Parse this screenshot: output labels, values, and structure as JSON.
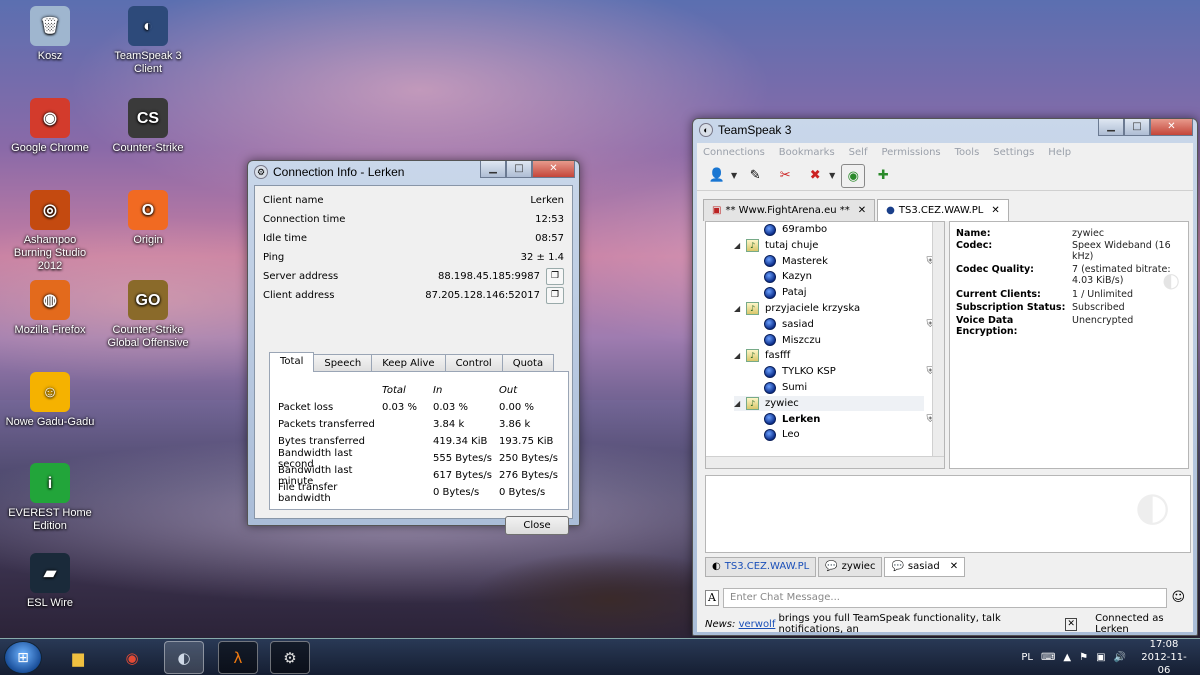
{
  "desktop": {
    "icons": [
      {
        "label": "Kosz",
        "glyph": "🗑",
        "color": "#9fb6cf"
      },
      {
        "label": "TeamSpeak 3 Client",
        "glyph": "◐",
        "color": "#2d4a7a"
      },
      {
        "label": "Google Chrome",
        "glyph": "◉",
        "color": "#d33b2c"
      },
      {
        "label": "Counter-Strike",
        "glyph": "CS",
        "color": "#3a3a3a"
      },
      {
        "label": "Ashampoo Burning Studio 2012",
        "glyph": "◎",
        "color": "#c44a10"
      },
      {
        "label": "Origin",
        "glyph": "O",
        "color": "#f16a22"
      },
      {
        "label": "Mozilla Firefox",
        "glyph": "◍",
        "color": "#e36a1c"
      },
      {
        "label": "Counter-Strike Global Offensive",
        "glyph": "GO",
        "color": "#8a6a2a"
      },
      {
        "label": "Nowe Gadu-Gadu",
        "glyph": "☺",
        "color": "#f5b200"
      },
      {
        "label": "EVEREST Home Edition",
        "glyph": "i",
        "color": "#22a53a"
      },
      {
        "label": "ESL Wire",
        "glyph": "▰",
        "color": "#1a2a3a"
      }
    ]
  },
  "conn_info": {
    "title": "Connection Info - Lerken",
    "rows": [
      {
        "label": "Client name",
        "value": "Lerken"
      },
      {
        "label": "Connection time",
        "value": "12:53"
      },
      {
        "label": "Idle time",
        "value": "08:57"
      },
      {
        "label": "Ping",
        "value": "32 ± 1.4"
      },
      {
        "label": "Server address",
        "value": "88.198.45.185:9987"
      },
      {
        "label": "Client address",
        "value": "87.205.128.146:52017"
      }
    ],
    "tabs": [
      "Total",
      "Speech",
      "Keep Alive",
      "Control",
      "Quota"
    ],
    "table": {
      "headers": [
        "",
        "Total",
        "In",
        "Out"
      ],
      "rows": [
        [
          "Packet loss",
          "0.03 %",
          "0.03 %",
          "0.00 %"
        ],
        [
          "Packets transferred",
          "",
          "3.84 k",
          "3.86 k"
        ],
        [
          "Bytes transferred",
          "",
          "419.34 KiB",
          "193.75 KiB"
        ],
        [
          "Bandwidth last second",
          "",
          "555 Bytes/s",
          "250 Bytes/s"
        ],
        [
          "Bandwidth last minute",
          "",
          "617 Bytes/s",
          "276 Bytes/s"
        ],
        [
          "File transfer bandwidth",
          "",
          "0 Bytes/s",
          "0 Bytes/s"
        ]
      ]
    },
    "close_label": "Close"
  },
  "teamspeak": {
    "title": "TeamSpeak 3",
    "menu": [
      "Connections",
      "Bookmarks",
      "Self",
      "Permissions",
      "Tools",
      "Settings",
      "Help"
    ],
    "server_tabs": [
      {
        "label": "** Www.FightArena.eu **"
      },
      {
        "label": "TS3.CEZ.WAW.PL"
      }
    ],
    "tree": [
      {
        "type": "client",
        "label": "69rambo",
        "indent": 2
      },
      {
        "type": "channel",
        "label": "tutaj chuje",
        "indent": 1,
        "lock": true
      },
      {
        "type": "client",
        "label": "Masterek",
        "indent": 2,
        "badge": true
      },
      {
        "type": "client",
        "label": "Kazyn",
        "indent": 2
      },
      {
        "type": "client",
        "label": "Pataj",
        "indent": 2
      },
      {
        "type": "channel",
        "label": "przyjaciele krzyska",
        "indent": 1
      },
      {
        "type": "client",
        "label": "sasiad",
        "indent": 2,
        "badge": true
      },
      {
        "type": "client",
        "label": "Miszczu",
        "indent": 2
      },
      {
        "type": "channel",
        "label": "fasfff",
        "indent": 1,
        "lock": true
      },
      {
        "type": "client",
        "label": "TYLKO KSP",
        "indent": 2,
        "badge": true
      },
      {
        "type": "client",
        "label": "Sumi",
        "indent": 2
      },
      {
        "type": "channel",
        "label": "zywiec",
        "indent": 1,
        "selected": true
      },
      {
        "type": "client",
        "label": "Lerken",
        "indent": 2,
        "bold": true,
        "badge": true
      },
      {
        "type": "client",
        "label": "Leo",
        "indent": 2
      }
    ],
    "info": [
      {
        "key": "Name:",
        "value": "zywiec"
      },
      {
        "key": "Codec:",
        "value": "Speex Wideband (16 kHz)"
      },
      {
        "key": "Codec Quality:",
        "value": "7 (estimated bitrate: 4.03 KiB/s)"
      },
      {
        "key": "Current Clients:",
        "value": "1 / Unlimited"
      },
      {
        "key": "Subscription Status:",
        "value": "Subscribed"
      },
      {
        "key": "Voice Data Encryption:",
        "value": "Unencrypted"
      }
    ],
    "chat_tabs": [
      {
        "label": "TS3.CEZ.WAW.PL"
      },
      {
        "label": "zywiec"
      },
      {
        "label": "sasiad"
      }
    ],
    "chat_placeholder": "Enter Chat Message...",
    "news_label": "News:",
    "news_link": "verwolf",
    "news_text": "brings you full TeamSpeak functionality, talk notifications, an",
    "status": "Connected as Lerken"
  },
  "taskbar": {
    "lang": "PL",
    "time": "17:08",
    "date": "2012-11-06"
  },
  "colors": {
    "accent": "#1f5fcf",
    "link": "#1a4fb8"
  }
}
